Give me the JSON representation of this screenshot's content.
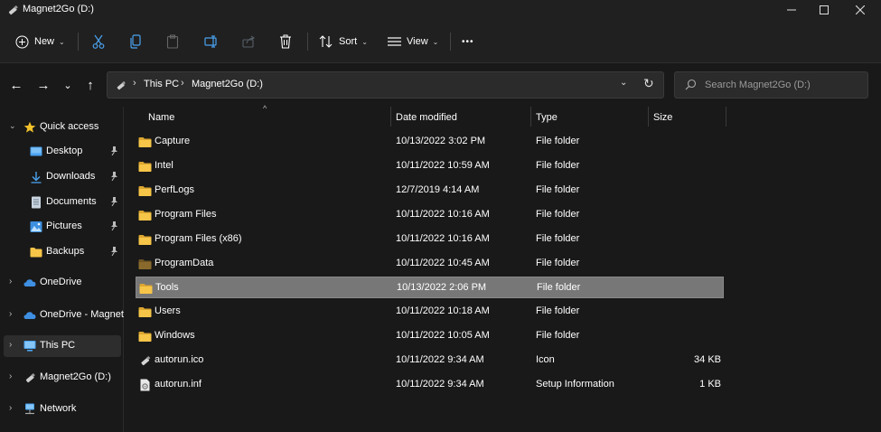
{
  "window": {
    "title": "Magnet2Go (D:)",
    "controls": {
      "minimize": "—",
      "maximize": "☐",
      "close": "✕"
    }
  },
  "commands": {
    "new_label": "New",
    "sort_label": "Sort",
    "view_label": "View",
    "more_label": "•••",
    "chevron": "⌄"
  },
  "address": {
    "crumbs": [
      "This PC",
      "Magnet2Go (D:)"
    ],
    "separator": "›",
    "dropdown": "⌄",
    "refresh": "↻"
  },
  "nav": {
    "back": "←",
    "forward": "→",
    "recent": "⌄",
    "up": "↑"
  },
  "search": {
    "placeholder": "Search Magnet2Go (D:)"
  },
  "sidebar": {
    "items": [
      {
        "label": "Quick access",
        "icon": "star-icon",
        "expand": "⌄"
      },
      {
        "label": "Desktop",
        "icon": "desktop-icon",
        "pinned": true
      },
      {
        "label": "Downloads",
        "icon": "download-icon",
        "pinned": true
      },
      {
        "label": "Documents",
        "icon": "document-icon",
        "pinned": true
      },
      {
        "label": "Pictures",
        "icon": "picture-icon",
        "pinned": true
      },
      {
        "label": "Backups",
        "icon": "folder-icon",
        "pinned": true
      },
      {
        "label": "OneDrive",
        "icon": "cloud-icon",
        "expand": "›"
      },
      {
        "label": "OneDrive - Magnet",
        "icon": "cloud-icon",
        "expand": "›"
      },
      {
        "label": "This PC",
        "icon": "computer-icon",
        "expand": "›"
      },
      {
        "label": "Magnet2Go (D:)",
        "icon": "drive-icon",
        "expand": "›"
      },
      {
        "label": "Network",
        "icon": "network-icon",
        "expand": "›"
      }
    ],
    "pin_glyph": "📌"
  },
  "columns": {
    "name": "Name",
    "date": "Date modified",
    "type": "Type",
    "size": "Size",
    "sort_indicator": "^"
  },
  "files": [
    {
      "name": "Capture",
      "date": "10/13/2022 3:02 PM",
      "type": "File folder",
      "size": "",
      "icon": "folder-icon"
    },
    {
      "name": "Intel",
      "date": "10/11/2022 10:59 AM",
      "type": "File folder",
      "size": "",
      "icon": "folder-icon"
    },
    {
      "name": "PerfLogs",
      "date": "12/7/2019 4:14 AM",
      "type": "File folder",
      "size": "",
      "icon": "folder-icon"
    },
    {
      "name": "Program Files",
      "date": "10/11/2022 10:16 AM",
      "type": "File folder",
      "size": "",
      "icon": "folder-icon"
    },
    {
      "name": "Program Files (x86)",
      "date": "10/11/2022 10:16 AM",
      "type": "File folder",
      "size": "",
      "icon": "folder-icon"
    },
    {
      "name": "ProgramData",
      "date": "10/11/2022 10:45 AM",
      "type": "File folder",
      "size": "",
      "icon": "hidden-folder-icon"
    },
    {
      "name": "Tools",
      "date": "10/13/2022 2:06 PM",
      "type": "File folder",
      "size": "",
      "icon": "folder-icon",
      "selected": true
    },
    {
      "name": "Users",
      "date": "10/11/2022 10:18 AM",
      "type": "File folder",
      "size": "",
      "icon": "folder-icon"
    },
    {
      "name": "Windows",
      "date": "10/11/2022 10:05 AM",
      "type": "File folder",
      "size": "",
      "icon": "folder-icon"
    },
    {
      "name": "autorun.ico",
      "date": "10/11/2022 9:34 AM",
      "type": "Icon",
      "size": "34 KB",
      "icon": "usb-drive-icon"
    },
    {
      "name": "autorun.inf",
      "date": "10/11/2022 9:34 AM",
      "type": "Setup Information",
      "size": "1 KB",
      "icon": "settings-file-icon"
    }
  ],
  "colors": {
    "folder": "#f7c548",
    "folder_dark": "#dca630",
    "hidden_folder": "#8a6a2c",
    "accent_blue": "#3c9be8",
    "selection": "#777777"
  }
}
